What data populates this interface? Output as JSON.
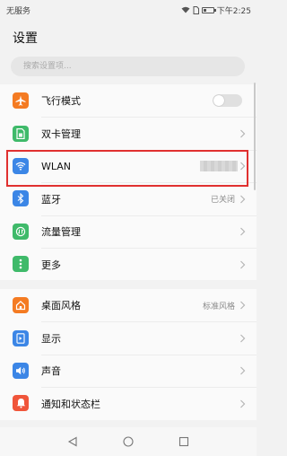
{
  "status_bar": {
    "carrier": "无服务",
    "time": "下午2:25",
    "battery_level": 0.35
  },
  "page": {
    "title": "设置"
  },
  "search": {
    "placeholder": "搜索设置项..."
  },
  "highlight_color": "#e0302f",
  "group1": [
    {
      "label": "飞行模式",
      "icon": "airplane-icon",
      "color": "#f47b22",
      "control": "toggle",
      "toggle_on": false
    },
    {
      "label": "双卡管理",
      "icon": "sim-card-icon",
      "color": "#3fba6a",
      "control": "chevron"
    },
    {
      "label": "WLAN",
      "icon": "wifi-icon",
      "color": "#3b86e6",
      "control": "chevron",
      "value_obscured": true
    },
    {
      "label": "蓝牙",
      "value": "已关闭",
      "icon": "bluetooth-icon",
      "color": "#3b86e6",
      "control": "chevron"
    },
    {
      "label": "流量管理",
      "icon": "data-usage-icon",
      "color": "#3fba6a",
      "control": "chevron"
    },
    {
      "label": "更多",
      "icon": "more-icon",
      "color": "#3fba6a",
      "control": "chevron"
    }
  ],
  "group2": [
    {
      "label": "桌面风格",
      "value": "标准风格",
      "icon": "home-style-icon",
      "color": "#f47b22",
      "control": "chevron"
    },
    {
      "label": "显示",
      "icon": "display-icon",
      "color": "#3b86e6",
      "control": "chevron"
    },
    {
      "label": "声音",
      "icon": "sound-icon",
      "color": "#3b86e6",
      "control": "chevron"
    },
    {
      "label": "通知和状态栏",
      "icon": "notification-icon",
      "color": "#f0553a",
      "control": "chevron"
    }
  ]
}
